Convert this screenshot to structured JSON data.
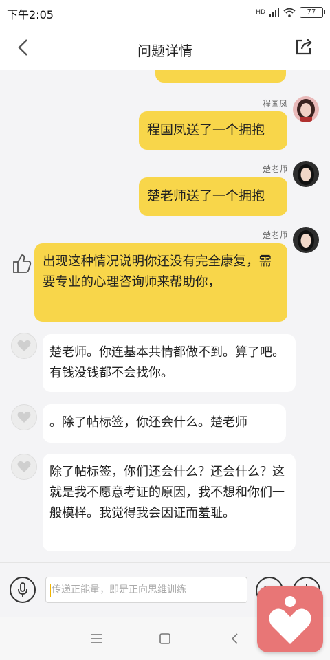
{
  "status": {
    "time": "下午2:05",
    "battery": "77",
    "signal_label": "HD"
  },
  "header": {
    "title": "问题详情"
  },
  "messages": {
    "m1": {
      "sender": "程国凤",
      "text": "程国凤送了一个拥抱"
    },
    "m2": {
      "sender": "楚老师",
      "text": "楚老师送了一个拥抱"
    },
    "m3": {
      "sender": "楚老师",
      "text": "出现这种情况说明你还没有完全康复，需要专业的心理咨询师来帮助你，"
    },
    "m4": {
      "text": "楚老师。你连基本共情都做不到。算了吧。有钱没钱都不会找你。"
    },
    "m5": {
      "text": "。除了帖标签，你还会什么。楚老师"
    },
    "m6": {
      "text": "除了帖标签，你们还会什么？还会什么？这就是我不愿意考证的原因，我不想和你们一般模样。我觉得我会因证而羞耻。"
    }
  },
  "input": {
    "placeholder": "传递正能量，即是正向思维训练"
  },
  "colors": {
    "bubble_yellow": "#f8d64a",
    "chat_bg": "#f4f4f6",
    "floating_button": "#e87676"
  }
}
